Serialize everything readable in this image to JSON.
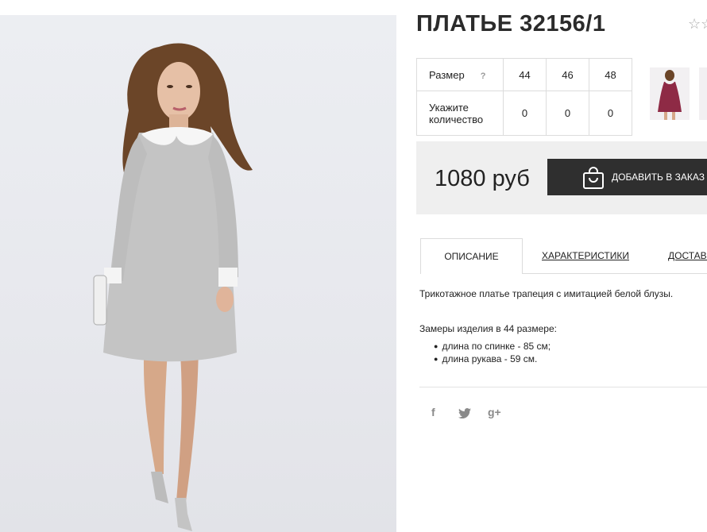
{
  "product": {
    "title": "ПЛАТЬЕ 32156/1",
    "star_icon": "☆☆"
  },
  "size_table": {
    "size_label": "Размер",
    "help": "?",
    "sizes": [
      "44",
      "46",
      "48"
    ],
    "qty_label_line1": "Укажите",
    "qty_label_line2": "количество",
    "quantities": [
      "0",
      "0",
      "0"
    ]
  },
  "buy": {
    "price": "1080 руб",
    "add_label": "ДОБАВИТЬ В ЗАКАЗ"
  },
  "tabs": [
    {
      "label": "ОПИСАНИЕ",
      "active": true
    },
    {
      "label": "ХАРАКТЕРИСТИКИ",
      "active": false
    },
    {
      "label": "ДОСТАВКА",
      "active": false
    }
  ],
  "description": {
    "text": "Трикотажное платье трапеция с имитацией белой блузы.",
    "measurements_title": "Замеры изделия в 44 размере:",
    "measurements": [
      "длина по спинке - 85 см;",
      "длина рукава - 59 см."
    ]
  },
  "social": {
    "facebook": "f",
    "twitter": "twitter-icon",
    "google": "g+"
  },
  "colors": {
    "button_bg": "#2f2f2f",
    "price_bar_bg": "#efefef",
    "dress_gray": "#c4c4c4",
    "thumb_dress": "#8e2a45"
  }
}
